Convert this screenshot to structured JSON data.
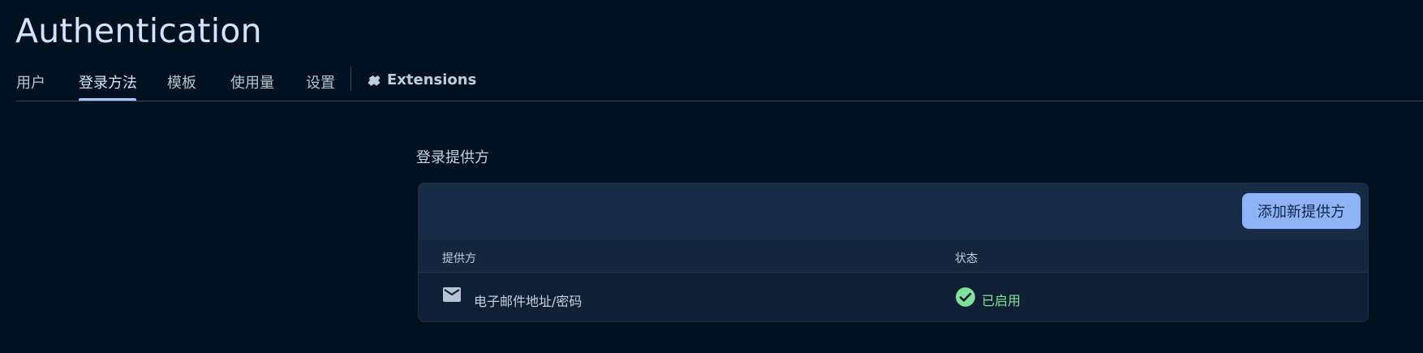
{
  "header": {
    "title": "Authentication"
  },
  "tabs": [
    {
      "label": "用户",
      "active": false
    },
    {
      "label": "登录方法",
      "active": true
    },
    {
      "label": "模板",
      "active": false
    },
    {
      "label": "使用量",
      "active": false
    },
    {
      "label": "设置",
      "active": false
    },
    {
      "label": "Extensions",
      "active": false,
      "icon": "extensions-puzzle-icon"
    }
  ],
  "providers_section": {
    "title": "登录提供方",
    "add_button_label": "添加新提供方",
    "table": {
      "columns": [
        "提供方",
        "状态"
      ],
      "rows": [
        {
          "icon": "mail-icon",
          "provider": "电子邮件地址/密码",
          "status_icon": "check-circle-icon",
          "status": "已启用"
        }
      ]
    }
  },
  "colors": {
    "background": "#02111f",
    "accent": "#a8c8ff",
    "button": "#8eb3f6",
    "enabled": "#7ee29a"
  }
}
